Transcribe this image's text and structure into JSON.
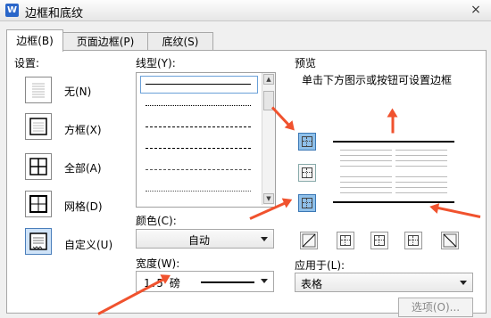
{
  "window": {
    "title": "边框和底纹",
    "app_logo": "W",
    "close": "×"
  },
  "tabs": [
    "边框(B)",
    "页面边框(P)",
    "底纹(S)"
  ],
  "settings": {
    "label": "设置:",
    "items": [
      {
        "label": "无(N)",
        "icon": "none-border-icon"
      },
      {
        "label": "方框(X)",
        "icon": "box-border-icon"
      },
      {
        "label": "全部(A)",
        "icon": "all-border-icon"
      },
      {
        "label": "网格(D)",
        "icon": "grid-border-icon"
      },
      {
        "label": "自定义(U)",
        "icon": "custom-border-icon",
        "selected": true
      }
    ]
  },
  "line_style": {
    "label": "线型(Y):"
  },
  "color": {
    "label": "颜色(C):",
    "value": "自动"
  },
  "width": {
    "label": "宽度(W):",
    "value": "1.5 磅"
  },
  "preview": {
    "label": "预览",
    "hint": "单击下方图示或按钮可设置边框"
  },
  "apply_to": {
    "label": "应用于(L):",
    "value": "表格"
  },
  "options_button": "选项(O)...",
  "accent_color": "#f0522e"
}
